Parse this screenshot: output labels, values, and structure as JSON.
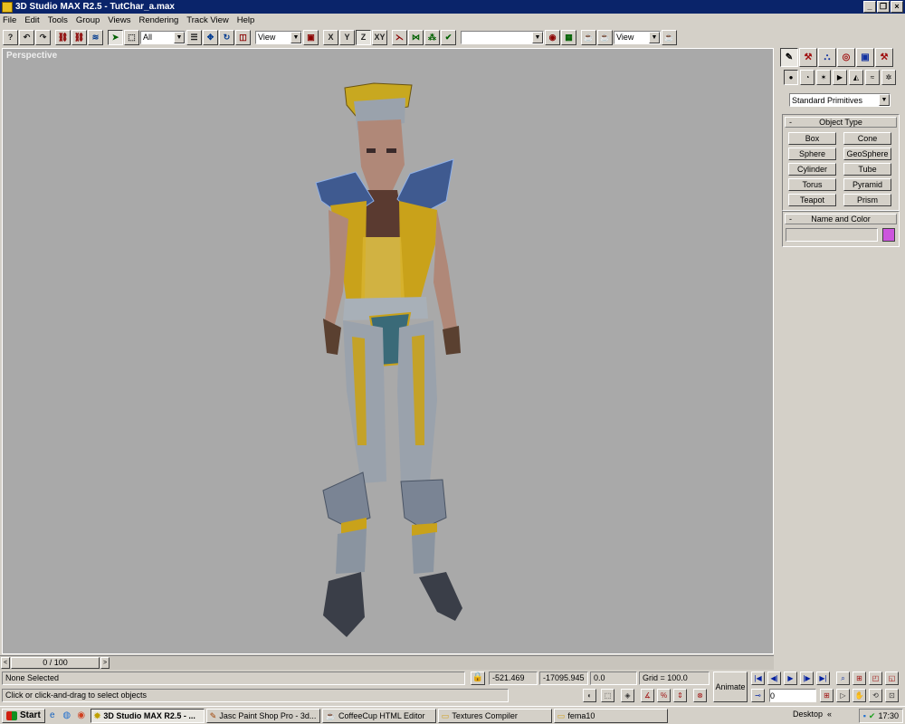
{
  "window": {
    "title": "3D Studio MAX R2.5 - TutChar_a.max",
    "btn_min": "_",
    "btn_restore": "❐",
    "btn_close": "×"
  },
  "menu": [
    "File",
    "Edit",
    "Tools",
    "Group",
    "Views",
    "Rendering",
    "Track View",
    "Help"
  ],
  "toolbar": {
    "selection_filter": "All",
    "ref_coord": "View",
    "axis_x": "X",
    "axis_y": "Y",
    "axis_z": "Z",
    "axis_xy": "XY",
    "named_selection": "",
    "render_type": "View",
    "dd_arrow": "▼"
  },
  "viewport": {
    "label": "Perspective"
  },
  "command_panel": {
    "dropdown": "Standard Primitives",
    "object_type_title": "Object Type",
    "object_buttons": [
      "Box",
      "Cone",
      "Sphere",
      "GeoSphere",
      "Cylinder",
      "Tube",
      "Torus",
      "Pyramid",
      "Teapot",
      "Prism"
    ],
    "name_color_title": "Name and Color",
    "name_value": "",
    "object_color": "#cc55dd",
    "collapse": "-"
  },
  "time_slider": {
    "frame": "0 / 100",
    "left": "<",
    "right": ">"
  },
  "status": {
    "selection": "None Selected",
    "prompt": "Click or click-and-drag to select objects",
    "x": "-521.469",
    "y": "-17095.945",
    "z": "0.0",
    "grid": "Grid = 100.0",
    "animate": "Animate",
    "current_frame": "0"
  },
  "anim_controls": {
    "go_start": "|◀",
    "prev": "◀|",
    "play": "▶",
    "next": "|▶",
    "go_end": "▶|",
    "key": "⊸"
  },
  "taskbar": {
    "start": "Start",
    "tasks": [
      "3D Studio MAX R2.5 - ...",
      "Jasc Paint Shop Pro - 3d...",
      "CoffeeCup HTML Editor",
      "Textures Compiler",
      "fema10"
    ],
    "desktop": "Desktop",
    "chevron": "«",
    "clock": "17:30"
  }
}
